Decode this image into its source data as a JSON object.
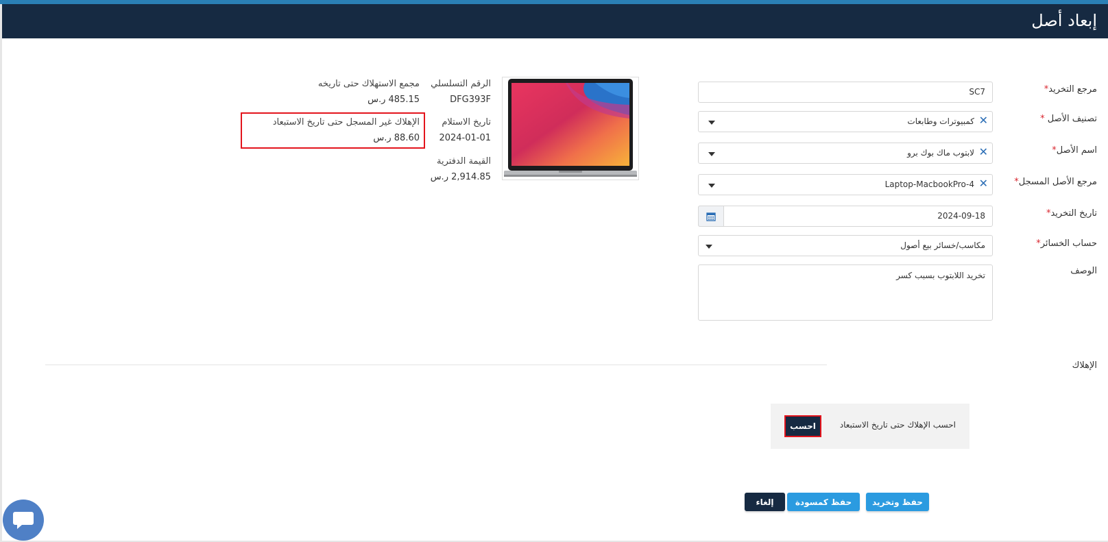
{
  "header": {
    "title": "إبعاد أصل"
  },
  "form": {
    "disposal_ref": {
      "label": "مرجع التخريد",
      "value": "SC7"
    },
    "asset_category": {
      "label": "تصنيف الأصل",
      "value": "كمبيوترات وطابعات"
    },
    "asset_name": {
      "label": "اسم الأصل",
      "value": "لابتوب ماك بوك برو"
    },
    "registered_asset_ref": {
      "label": "مرجع الأصل المسجل",
      "value": "Laptop-MacbookPro-4"
    },
    "disposal_date": {
      "label": "تاريخ التخريد",
      "value": "2024-09-18"
    },
    "loss_account": {
      "label": "حساب الخسائر",
      "value": "مكاسب/خسائر بيع أصول"
    },
    "description": {
      "label": "الوصف",
      "value": "تخريد اللابتوب بسبب كسر"
    },
    "required_mark": "*"
  },
  "asset_info": {
    "serial_label": "الرقم التسلسلي",
    "serial_value": "DFG393F",
    "receipt_date_label": "تاريخ الاستلام",
    "receipt_date_value": "2024-01-01",
    "book_value_label": "القيمة الدفترية",
    "book_value_value": "2,914.85 ر.س",
    "accum_dep_label": "مجمع الاستهلاك حتى تاريخه",
    "accum_dep_value": "485.15 ر.س",
    "unrecorded_dep_label": "الإهلاك غير المسجل حتى تاريخ الاستبعاد",
    "unrecorded_dep_value": "88.60 ر.س"
  },
  "depreciation": {
    "section_label": "الإهلاك",
    "calc_label": "احسب الإهلاك حتى تاريخ الاستبعاد",
    "calc_button": "احسب"
  },
  "actions": {
    "save_dispose": "حفظ وتخريد",
    "save_draft": "حفظ كمسودة",
    "cancel": "إلغاء"
  },
  "colors": {
    "header_bg": "#162a42",
    "accent_blue": "#2b9be0",
    "highlight_red": "#e3141c"
  }
}
